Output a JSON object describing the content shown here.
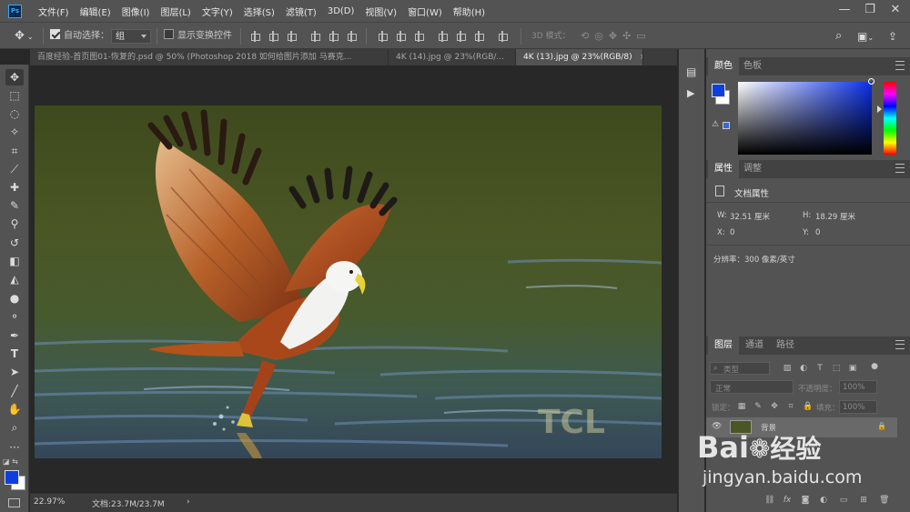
{
  "app": {
    "logo": "Ps"
  },
  "menu": [
    "文件(F)",
    "编辑(E)",
    "图像(I)",
    "图层(L)",
    "文字(Y)",
    "选择(S)",
    "滤镜(T)",
    "3D(D)",
    "视图(V)",
    "窗口(W)",
    "帮助(H)"
  ],
  "window_controls": {
    "minimize": "—",
    "restore": "❐",
    "close": "✕"
  },
  "options": {
    "auto_select_label": "自动选择：",
    "auto_select_value": "组",
    "transform_label": "显示变换控件",
    "mode_3d": "3D 模式："
  },
  "tabs": [
    {
      "label": "百度经验-首页图01-恢复的.psd @ 50% (Photoshop 2018  如何给图片添加 马赛克...",
      "active": false
    },
    {
      "label": "4K (14).jpg @ 23%(RGB/...",
      "active": false
    },
    {
      "label": "4K (13).jpg @ 23%(RGB/8)",
      "active": true
    }
  ],
  "status": {
    "zoom": "22.97%",
    "doc": "文档:23.7M/23.7M",
    "arrow": "›"
  },
  "image_text": "TCL",
  "color_panel": {
    "tabs": [
      "颜色",
      "色板"
    ],
    "fg_color": "#0d3fe0",
    "bg_color": "#ffffff",
    "field_hue": "#0a2fe8"
  },
  "properties_panel": {
    "tabs": [
      "属性",
      "调整"
    ],
    "title": "文档属性",
    "w_label": "W:",
    "w_value": "32.51 厘米",
    "h_label": "H:",
    "h_value": "18.29 厘米",
    "x_label": "X:",
    "x_value": "0",
    "y_label": "Y:",
    "y_value": "0",
    "resolution": "分辨率：300 像素/英寸"
  },
  "layers_panel": {
    "tabs": [
      "图层",
      "通道",
      "路径"
    ],
    "filter_placeholder": "类型",
    "blend_mode": "正常",
    "opacity_label": "不透明度：",
    "opacity_value": "100%",
    "lock_label": "锁定：",
    "fill_label": "填充：",
    "fill_value": "100%",
    "layer_name": "背景"
  },
  "watermark": {
    "brand": "Bai",
    "brand_cn": "经验",
    "url": "jingyan.baidu.com"
  }
}
